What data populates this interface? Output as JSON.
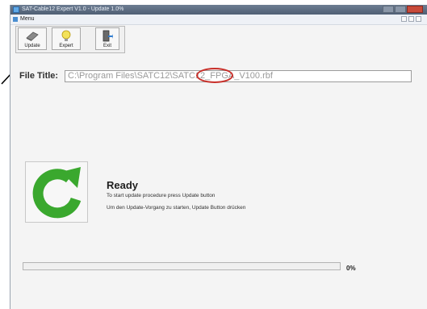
{
  "window": {
    "title": "SAT-Cable12 Expert V1.0 - Update 1.0%"
  },
  "menubar": {
    "menu_label": "Menu"
  },
  "toolbar": {
    "update_label": "Update",
    "expert_label": "Expert",
    "exit_label": "Exit"
  },
  "file": {
    "label": "File Title:",
    "path": "C:\\Program Files\\SATC12\\SATC12_FPGA_V100.rbf"
  },
  "status": {
    "title": "Ready",
    "line1": "To start update procedure press Update button",
    "line2": "Um den Update-Vorgang zu starten, Update Button drücken"
  },
  "progress": {
    "percent_text": "0%",
    "fraction": 0
  },
  "colors": {
    "refresh_icon": "#3aa82e",
    "annotation": "#c8302a"
  }
}
